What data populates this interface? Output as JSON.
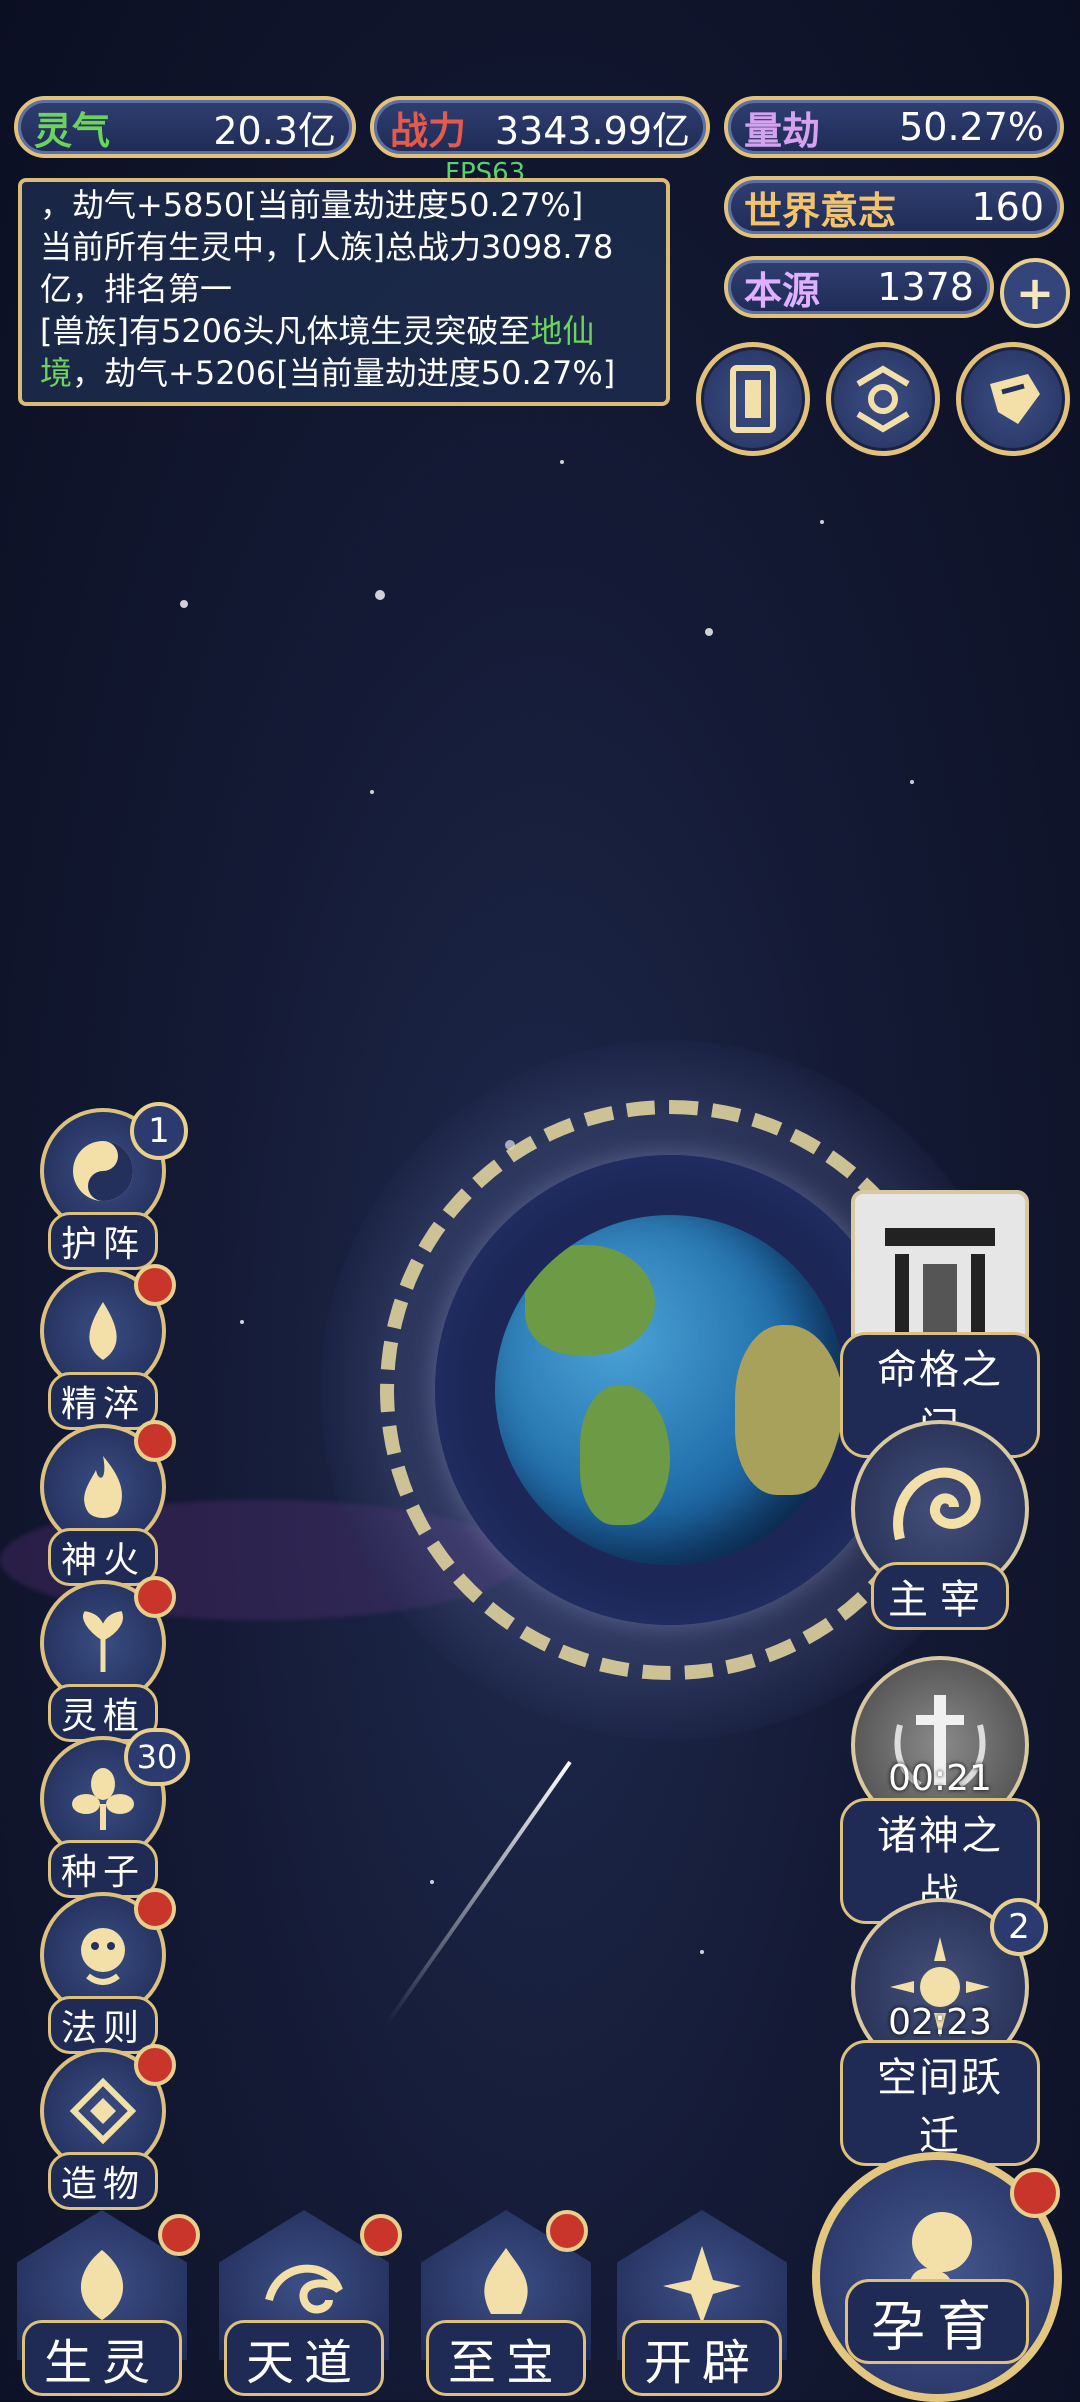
{
  "resources": {
    "lingqi": {
      "label": "灵气",
      "value": "20.3亿",
      "color": "#6cd45a"
    },
    "zhanli": {
      "label": "战力",
      "value": "3343.99亿",
      "color": "#e55a4a"
    },
    "liangjie": {
      "label": "量劫",
      "value": "50.27%",
      "color": "#d6a2f0"
    },
    "shijieyizhi": {
      "label": "世界意志",
      "value": "160",
      "color": "#f2c36b"
    },
    "benyuan": {
      "label": "本源",
      "value": "1378",
      "color": "#e0b0ff"
    }
  },
  "fps": "FPS63",
  "log": {
    "line1": "，劫气+5850[当前量劫进度50.27%]",
    "line2": "当前所有生灵中，[人族]总战力3098.78亿，排名第一",
    "line3_a": "[兽族]有5206头凡体境生灵突破至",
    "line3_green": "地仙境",
    "line3_b": "，劫气+5206[当前量劫进度50.27%]"
  },
  "plus_symbol": "+",
  "left_menu": [
    {
      "label": "护阵",
      "badge": "1"
    },
    {
      "label": "精淬"
    },
    {
      "label": "神火"
    },
    {
      "label": "灵植"
    },
    {
      "label": "种子",
      "badge": "30"
    },
    {
      "label": "法则"
    },
    {
      "label": "造物"
    }
  ],
  "right_menu": {
    "minggezhimen": {
      "label": "命格之门"
    },
    "zhuzai": {
      "label": "主宰"
    },
    "zhushenzhizhan": {
      "label": "诸神之战",
      "timer": "00:21"
    },
    "kongjianyueqian": {
      "label": "空间跃迁",
      "timer": "02:23",
      "badge": "2"
    }
  },
  "bottom_menu": {
    "shengling": "生灵",
    "tiandao": "天道",
    "zhibao": "至宝",
    "kaipi": "开辟",
    "yunyu": "孕育"
  }
}
